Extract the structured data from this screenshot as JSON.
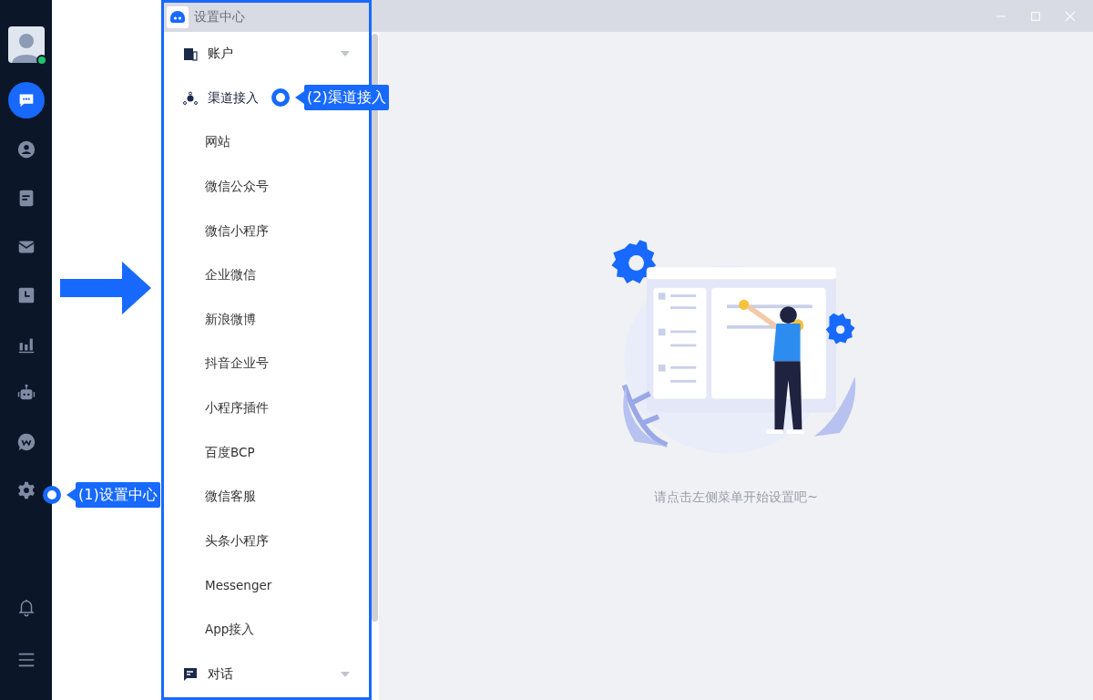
{
  "sidebar": {
    "avatar": {
      "online": true
    },
    "items": [
      {
        "kind": "chat",
        "selected": true
      },
      {
        "kind": "contact",
        "selected": false
      },
      {
        "kind": "clipboard",
        "selected": false
      },
      {
        "kind": "mail",
        "selected": false
      },
      {
        "kind": "clock",
        "selected": false
      },
      {
        "kind": "chart",
        "selected": false
      },
      {
        "kind": "robot",
        "selected": false
      },
      {
        "kind": "w-bubble",
        "selected": false
      },
      {
        "kind": "gear",
        "selected": false
      }
    ],
    "bottom_items": [
      {
        "kind": "bell"
      },
      {
        "kind": "menu"
      }
    ]
  },
  "window": {
    "title": "设置中心"
  },
  "menu": [
    {
      "kind": "building",
      "label": "账户",
      "expanded": false
    },
    {
      "kind": "network",
      "label": "渠道接入",
      "expanded": true,
      "children": [
        "网站",
        "微信公众号",
        "微信小程序",
        "企业微信",
        "新浪微博",
        "抖音企业号",
        "小程序插件",
        "百度BCP",
        "微信客服",
        "头条小程序",
        "Messenger",
        "App接入"
      ]
    },
    {
      "kind": "comment",
      "label": "对话",
      "expanded": false
    }
  ],
  "empty_state": {
    "message": "请点击左侧菜单开始设置吧~"
  },
  "callouts": [
    {
      "label": "(1)设置中心"
    },
    {
      "label": "(2)渠道接入"
    }
  ]
}
